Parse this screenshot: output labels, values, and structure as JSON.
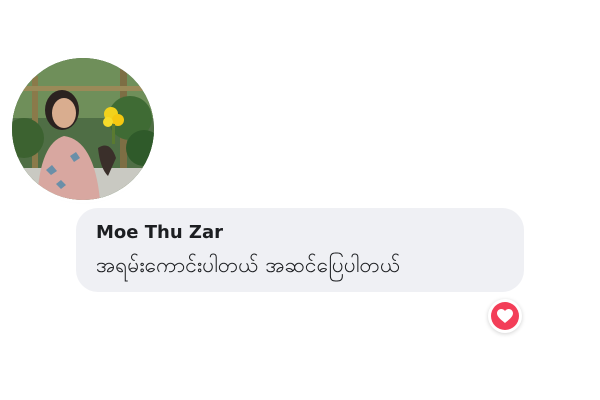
{
  "comment": {
    "author": "Moe Thu Zar",
    "text": "အရမ်းကောင်းပါတယ် အဆင်ပြေပါတယ်"
  },
  "avatar": {
    "description_icon": "profile-photo"
  },
  "reaction": {
    "icon": "heart-icon",
    "color": "#f33e58"
  },
  "colors": {
    "bubble": "#eff0f4",
    "text": "#1c1e21"
  }
}
